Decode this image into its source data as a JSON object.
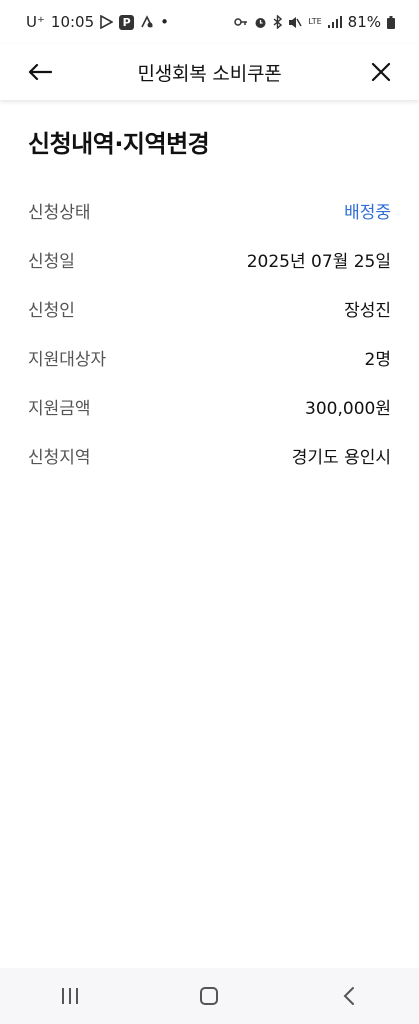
{
  "status_bar": {
    "carrier": "U⁺",
    "time": "10:05",
    "badge_p": "P",
    "dot": "•",
    "network": "LTE",
    "battery": "81%"
  },
  "header": {
    "title": "민생회복 소비쿠폰"
  },
  "page": {
    "title": "신청내역·지역변경"
  },
  "info": {
    "rows": [
      {
        "label": "신청상태",
        "value": "배정중"
      },
      {
        "label": "신청일",
        "value": "2025년 07월 25일"
      },
      {
        "label": "신청인",
        "value": "장성진"
      },
      {
        "label": "지원대상자",
        "value": "2명"
      },
      {
        "label": "지원금액",
        "value": "300,000원"
      },
      {
        "label": "신청지역",
        "value": "경기도 용인시"
      }
    ]
  },
  "colors": {
    "accent": "#2f6fd6"
  },
  "icons": [
    "back-arrow-icon",
    "close-icon",
    "recents-icon",
    "home-icon",
    "nav-back-icon"
  ]
}
